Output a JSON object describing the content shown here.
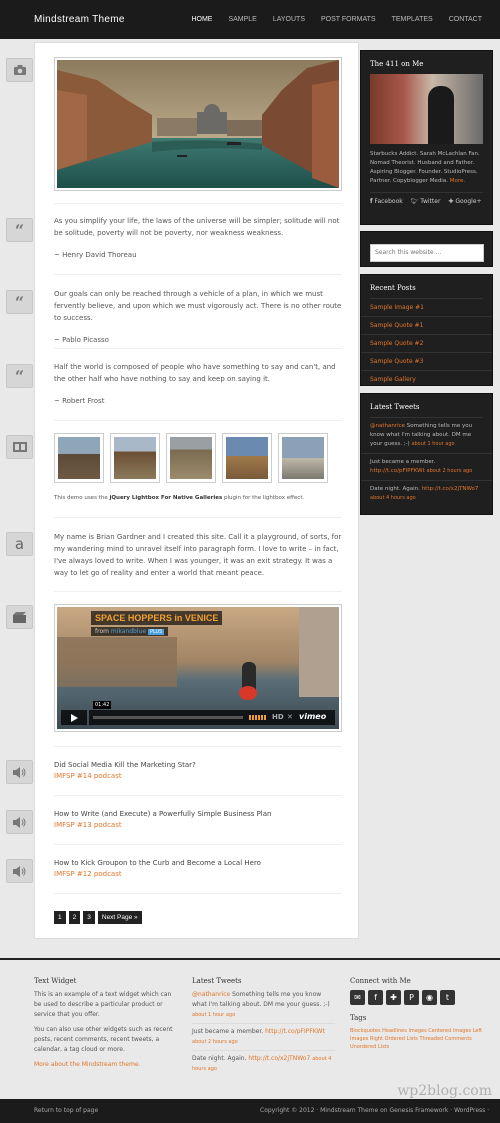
{
  "header": {
    "logo": "Mindstream Theme",
    "nav": [
      "Home",
      "Sample",
      "Layouts",
      "Post Formats",
      "Templates",
      "Contact"
    ]
  },
  "posts": {
    "quote1": {
      "text": "As you simplify your life, the laws of the universe will be simpler; solitude will not be solitude, poverty will not be poverty, nor weakness weakness.",
      "author": "~ Henry David Thoreau"
    },
    "quote2": {
      "text": "Our goals can only be reached through a vehicle of a plan, in which we must fervently believe, and upon which we must vigorously act. There is no other route to success.",
      "author": "~ Pablo Picasso"
    },
    "quote3": {
      "text": "Half the world is composed of people who have something to say and can't, and the other half who have nothing to say and keep on saying it.",
      "author": "~ Robert Frost"
    },
    "gallery": {
      "pre": "This demo uses the ",
      "link": "jQuery Lightbox For Native Galleries",
      "post": " plugin for the lightbox effect."
    },
    "aside": {
      "text": "My name is Brian Gardner and I created this site. Call it a playground, of sorts, for my wandering mind to unravel itself into paragraph form. I love to write – in fact, I've always loved to write. When I was younger, it was an exit strategy. It was a way to let go of reality and enter a world that meant peace."
    },
    "video": {
      "title": "SPACE HOPPERS in VENICE",
      "from": "from",
      "author": "mikandblue",
      "badge": "PLUS",
      "time": "01:42",
      "brand": "vimeo"
    },
    "audio": [
      {
        "title": "Did Social Media Kill the Marketing Star?",
        "podcast": "IMFSP #14 podcast"
      },
      {
        "title": "How to Write (and Execute) a Powerfully Simple Business Plan",
        "podcast": "IMFSP #13 podcast"
      },
      {
        "title": "How to Kick Groupon to the Curb and Become a Local Hero",
        "podcast": "IMFSP #12 podcast"
      }
    ]
  },
  "pagination": {
    "pages": [
      "1",
      "2",
      "3"
    ],
    "next": "Next Page »"
  },
  "sidebar": {
    "about": {
      "title": "The 411 on Me",
      "text": "Starbucks Addict. Sarah McLachlan Fan. Nomad Theorist. Husband and Father. Aspiring Blogger. Founder. StudioPress. Partner. Copyblogger Media.",
      "more": "More.",
      "links": [
        "Facebook",
        "Twitter",
        "Google+"
      ]
    },
    "search": {
      "placeholder": "Search this website ..."
    },
    "recent": {
      "title": "Recent Posts",
      "items": [
        "Sample Image #1",
        "Sample Quote #1",
        "Sample Quote #2",
        "Sample Quote #3",
        "Sample Gallery"
      ]
    },
    "tweets": {
      "title": "Latest Tweets",
      "items": [
        {
          "handle": "@nathanrice",
          "text": " Something tells me you know what I'm talking about. DM me your guess. ;-)",
          "time": "about 1 hour ago"
        },
        {
          "handle": "",
          "text": "Just became a member. ",
          "link": "http://t.co/pFIPFKWt",
          "time": "about 2 hours ago"
        },
        {
          "handle": "",
          "text": "Date night. Again. ",
          "link": "http://t.co/x2jTNWo7",
          "time": "about 4 hours ago"
        }
      ]
    }
  },
  "footer": {
    "text_widget": {
      "title": "Text Widget",
      "p1": "This is an example of a text widget which can be used to describe a particular product or service that you offer.",
      "p2": "You can also use other widgets such as recent posts, recent comments, recent tweets, a calendar, a tag cloud or more.",
      "link": "More about the Mindstream theme."
    },
    "tweets": {
      "title": "Latest Tweets",
      "items": [
        {
          "handle": "@nathanrice",
          "text": " Something tells me you know what I'm talking about. DM me your guess. ;-)",
          "time": "about 1 hour ago"
        },
        {
          "handle": "",
          "text": "Just became a member. ",
          "link": "http://t.co/pFIPFKWt",
          "time": "about 2 hours ago"
        },
        {
          "handle": "",
          "text": "Date night. Again. ",
          "link": "http://t.co/x2jTNWo7",
          "time": "about 4 hours ago"
        }
      ]
    },
    "connect": {
      "title": "Connect with Me",
      "tags_title": "Tags",
      "tags": "Blockquotes Headlines Images Centered Images Left Images Right Ordered Lists Threaded Comments Unordered Lists"
    }
  },
  "bottom": {
    "left": "Return to top of page",
    "right": "Copyright © 2012 · Mindstream Theme on Genesis Framework · WordPress · Log in",
    "watermark": "wp2blog.com"
  },
  "colors": {
    "accent": "#e0762b",
    "dark": "#1b1b1b"
  }
}
